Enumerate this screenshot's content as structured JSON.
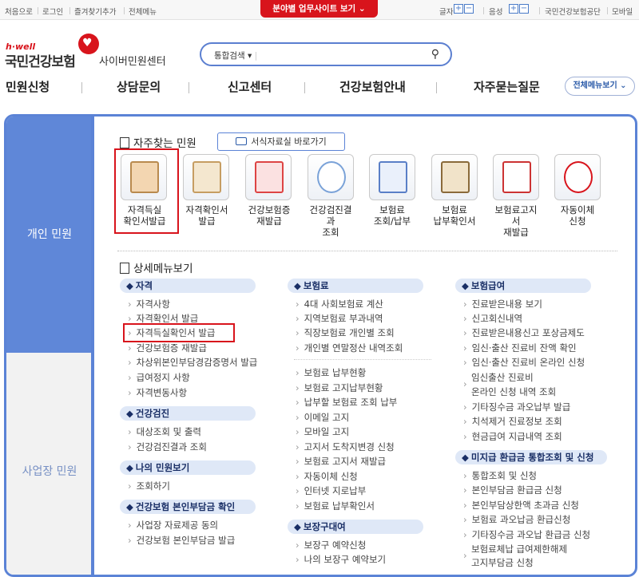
{
  "topbar": {
    "start": "처음으로",
    "login": "로그인",
    "fav": "즐겨찾기추가",
    "allmenu": "전체메뉴",
    "redtab": "분야별 업무사이트 보기",
    "fontsize": "글자",
    "volume": "음성",
    "org": "국민건강보험공단",
    "mobile": "모바일",
    "plus": "+",
    "minus": "−"
  },
  "logo": {
    "hwell": "h·well",
    "name": "국민건강보험",
    "center": "사이버민원센터"
  },
  "search": {
    "select": "통합검색",
    "value": ""
  },
  "gnb": [
    "민원신청",
    "상담문의",
    "신고센터",
    "건강보험안내",
    "자주묻는질문"
  ],
  "allmenu_btn": "전체메뉴보기",
  "side": {
    "personal": "개인 민원",
    "business": "사업장 민원"
  },
  "quick": {
    "title": "자주찾는 민원",
    "form_btn": "서식자료실 바로가기",
    "items": [
      {
        "label1": "자격득실",
        "label2": "확인서발급",
        "label3": "",
        "icon": "clipboard-icon"
      },
      {
        "label1": "자격확인서",
        "label2": "발급",
        "label3": "",
        "icon": "certificate-icon"
      },
      {
        "label1": "건강보험증",
        "label2": "재발급",
        "label3": "",
        "icon": "card-icon"
      },
      {
        "label1": "건강검진결",
        "label2": "과",
        "label3": "조회",
        "icon": "chart-icon"
      },
      {
        "label1": "보험료",
        "label2": "조회/납부",
        "label3": "",
        "icon": "won-icon"
      },
      {
        "label1": "보험료",
        "label2": "납부확인서",
        "label3": "",
        "icon": "glasses-icon"
      },
      {
        "label1": "보험료고지",
        "label2": "서",
        "label3": "재발급",
        "icon": "notice-icon"
      },
      {
        "label1": "자동이체",
        "label2": "신청",
        "label3": "",
        "icon": "refresh-icon"
      }
    ]
  },
  "detail": {
    "title": "상세메뉴보기",
    "col1": {
      "cat1": "자격",
      "cat1_items": [
        "자격사항",
        "자격확인서 발급",
        "자격득실확인서 발급",
        "건강보험증 재발급",
        "차상위본인부담경감증명서 발급",
        "급여정지 사항",
        "자격변동사항"
      ],
      "cat2": "건강검진",
      "cat2_items": [
        "대상조회 및 출력",
        "건강검진결과 조회"
      ],
      "cat3": "나의 민원보기",
      "cat3_items": [
        "조회하기"
      ],
      "cat4": "건강보험 본인부담금 확인",
      "cat4_items": [
        "사업장 자료제공 동의",
        "건강보험 본인부담금 발급"
      ]
    },
    "col2": {
      "cat1": "보험료",
      "cat1_items": [
        "4대 사회보험료 계산",
        "지역보험료 부과내역",
        "직장보험료 개인별 조회",
        "개인별 연말정산 내역조회"
      ],
      "cat1b_items": [
        "보험료 납부현황",
        "보험료 고지납부현황",
        "납부할 보험료 조회 납부",
        "이메일 고지",
        "모바일 고지",
        "고지서 도착지변경 신청",
        "보험료 고지서 재발급",
        "자동이체 신청",
        "인터넷 지로납부",
        "보험료 납부확인서"
      ],
      "cat2": "보장구대여",
      "cat2_items": [
        "보장구 예약신청",
        "나의 보장구 예약보기"
      ]
    },
    "col3": {
      "cat1": "보험급여",
      "cat1_items": [
        "진료받은내용 보기",
        "신고회신내역",
        "진료받은내용신고 포상금제도",
        "임신·출산 진료비 잔액 확인",
        "임신·출산 진료비 온라인 신청"
      ],
      "cat1_multi1": "임신출산 진료비",
      "cat1_multi2": "온라인 신청 내역 조회",
      "cat1_items2": [
        "기타징수금 과오납부 발급",
        "치석제거 진료정보 조회",
        "현금급여 지급내역 조회"
      ],
      "cat2": "미지급 환급금 통합조회 및 신청",
      "cat2_items": [
        "통합조회 및 신청",
        "본인부담금 환급금 신청",
        "본인부담상한액 초과금 신청",
        "보험료 과오납금 환급신청",
        "기타징수금 과오납 환급금 신청"
      ],
      "cat2_multi1": "보험료체납 급여제한해제",
      "cat2_multi2": "고지부담금 신청"
    }
  }
}
